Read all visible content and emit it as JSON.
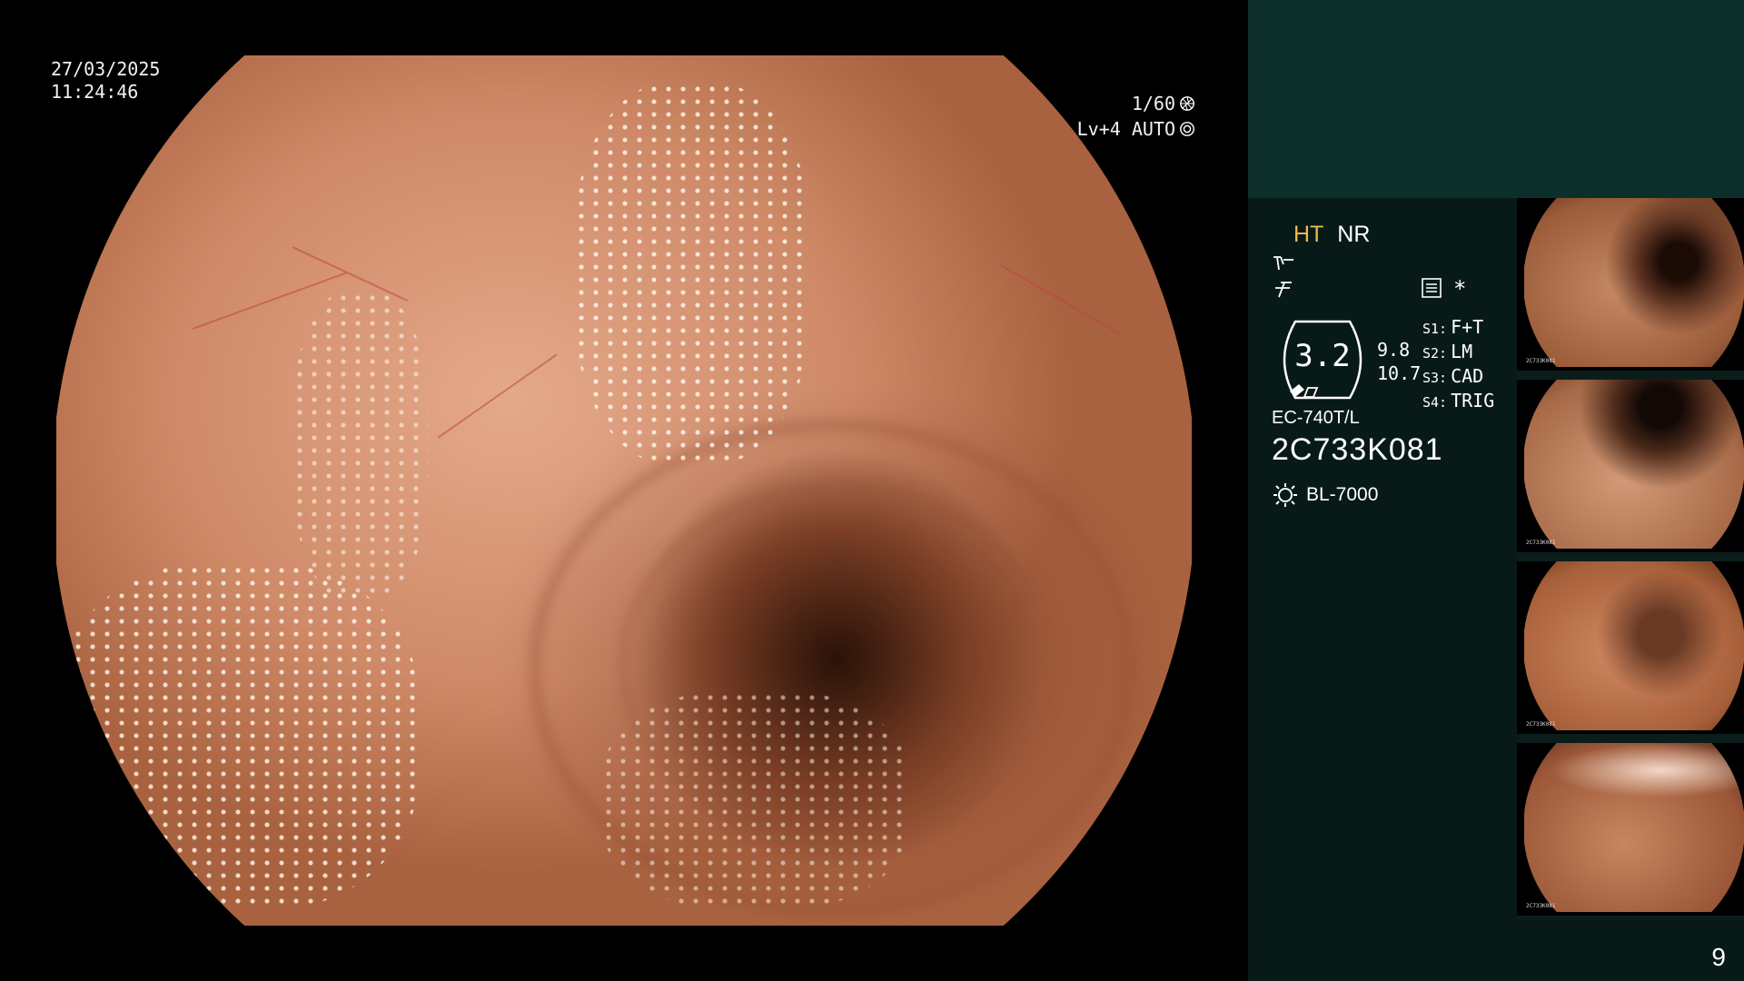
{
  "overlay": {
    "date": "27/03/2025",
    "time": "11:24:46",
    "shutter": "1/60",
    "level": "Lv+4 AUTO"
  },
  "panel": {
    "mode_ht": "HT",
    "mode_nr": "NR",
    "gauge_value": "3.2",
    "gauge_sub1": "9.8",
    "gauge_sub2": "10.7",
    "settings": [
      {
        "key": "S1:",
        "value": "F+T"
      },
      {
        "key": "S2:",
        "value": "LM"
      },
      {
        "key": "S3:",
        "value": "CAD"
      },
      {
        "key": "S4:",
        "value": "TRIG"
      }
    ],
    "scope_model": "EC-740T/L",
    "scope_serial": "2C733K081",
    "light_source": "BL-7000",
    "star": "*"
  },
  "thumbnails": [
    {
      "id": "thumb-1",
      "serial": "2C733K081"
    },
    {
      "id": "thumb-2",
      "serial": "2C733K081"
    },
    {
      "id": "thumb-3",
      "serial": "2C733K081"
    },
    {
      "id": "thumb-4",
      "serial": "2C733K081"
    }
  ],
  "page_number": "9",
  "colors": {
    "panel_top": "#0d2f2c",
    "panel": "#081a18",
    "mode_highlight": "#f2b84b"
  }
}
